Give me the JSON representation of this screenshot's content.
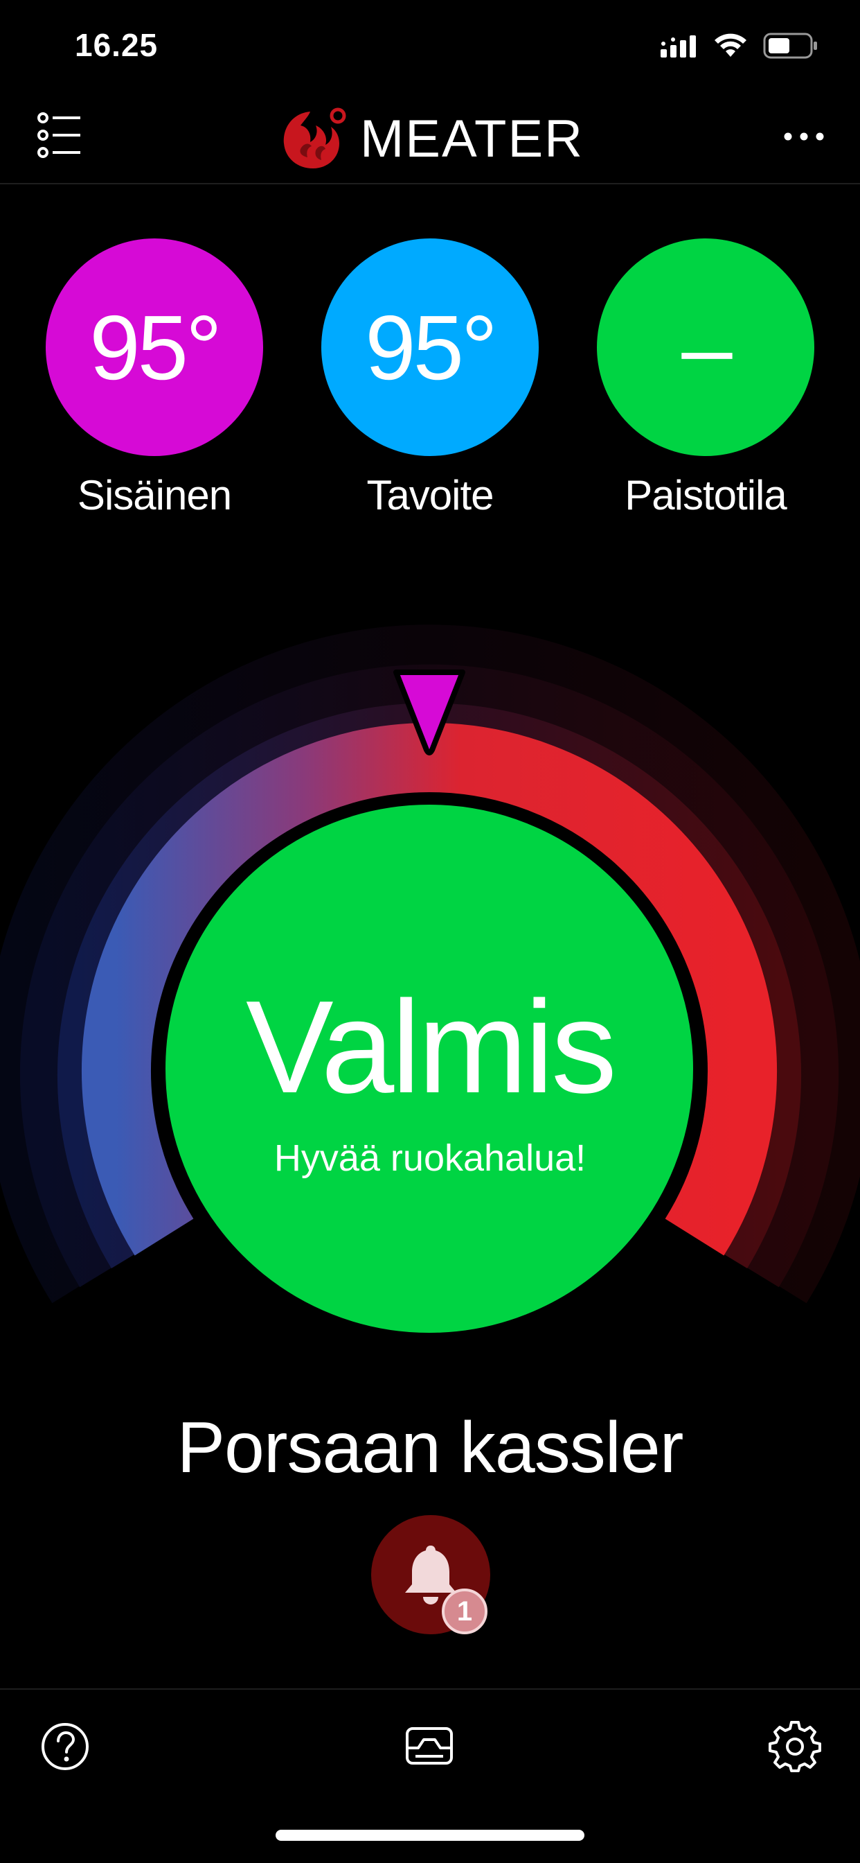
{
  "status_bar": {
    "time": "16.25",
    "icons": [
      "cellular-signal-icon",
      "wifi-icon",
      "battery-icon"
    ]
  },
  "header": {
    "brand": "MEATER",
    "menu_icon": "list-menu-icon",
    "more_icon": "more-dots-icon"
  },
  "stats": [
    {
      "value": "95°",
      "label": "Sisäinen",
      "color": "#d60ad6"
    },
    {
      "value": "95°",
      "label": "Tavoite",
      "color": "#00aaff"
    },
    {
      "value": "–",
      "label": "Paistotila",
      "color": "#00d443"
    }
  ],
  "cook": {
    "status_title": "Valmis",
    "status_subtitle": "Hyvää ruokahalua!",
    "status_color": "#00d443",
    "food_name": "Porsaan kassler",
    "alarm_count": "1",
    "alarm_color": "#6b0b0b"
  },
  "bottom_nav": {
    "items": [
      "help-icon",
      "graph-icon",
      "settings-gear-icon"
    ]
  },
  "colors": {
    "accent_magenta": "#d60ad6",
    "ring_red": "#e8222a",
    "ring_blue": "#3b5bb5"
  }
}
